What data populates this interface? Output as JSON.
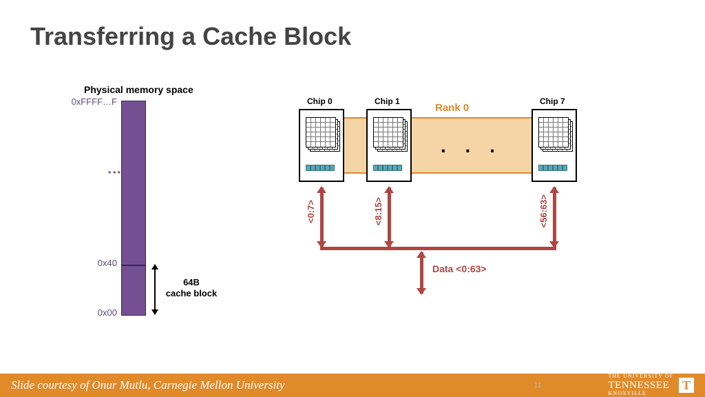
{
  "title": "Transferring a Cache Block",
  "memory": {
    "label": "Physical memory space",
    "top_addr": "0xFFFF…F",
    "mid_addr": "0x40",
    "bot_addr": "0x00",
    "block_label": "64B\ncache block"
  },
  "rank": {
    "label": "Rank 0",
    "chips": [
      {
        "label": "Chip 0",
        "range": "<0:7>"
      },
      {
        "label": "Chip 1",
        "range": "<8:15>"
      },
      {
        "label": "Chip 7",
        "range": "<56:63>"
      }
    ],
    "data_label": "Data <0:63>"
  },
  "footer": {
    "credit": "Slide courtesy of Onur Mutlu, Carnegie Mellon University",
    "page": "11",
    "university_small": "THE UNIVERSITY OF",
    "university": "TENNESSEE",
    "campus": "KNOXVILLE"
  }
}
